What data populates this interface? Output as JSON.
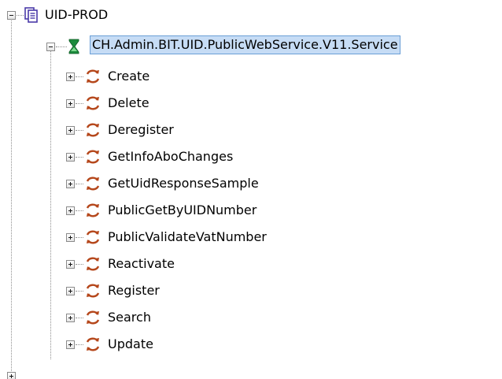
{
  "tree": {
    "root": {
      "label": "UID-PROD",
      "icon": "server-document-icon",
      "expanded": true
    },
    "service": {
      "label": "CH.Admin.BIT.UID.PublicWebService.V11.Service",
      "icon": "hourglass-service-icon",
      "expanded": true,
      "selected": true
    },
    "operations": [
      {
        "label": "Create"
      },
      {
        "label": "Delete"
      },
      {
        "label": "Deregister"
      },
      {
        "label": "GetInfoAboChanges"
      },
      {
        "label": "GetUidResponseSample"
      },
      {
        "label": "PublicGetByUIDNumber"
      },
      {
        "label": "PublicValidateVatNumber"
      },
      {
        "label": "Reactivate"
      },
      {
        "label": "Register"
      },
      {
        "label": "Search"
      },
      {
        "label": "Update"
      }
    ],
    "operation_icon": "sync-arrows-icon",
    "colors": {
      "selection_bg": "#c6dcf5",
      "selection_border": "#6b9fd6",
      "operation_icon": "#b5471b",
      "service_icon": "#1c8a3c",
      "root_icon": "#4a3aa8"
    }
  }
}
